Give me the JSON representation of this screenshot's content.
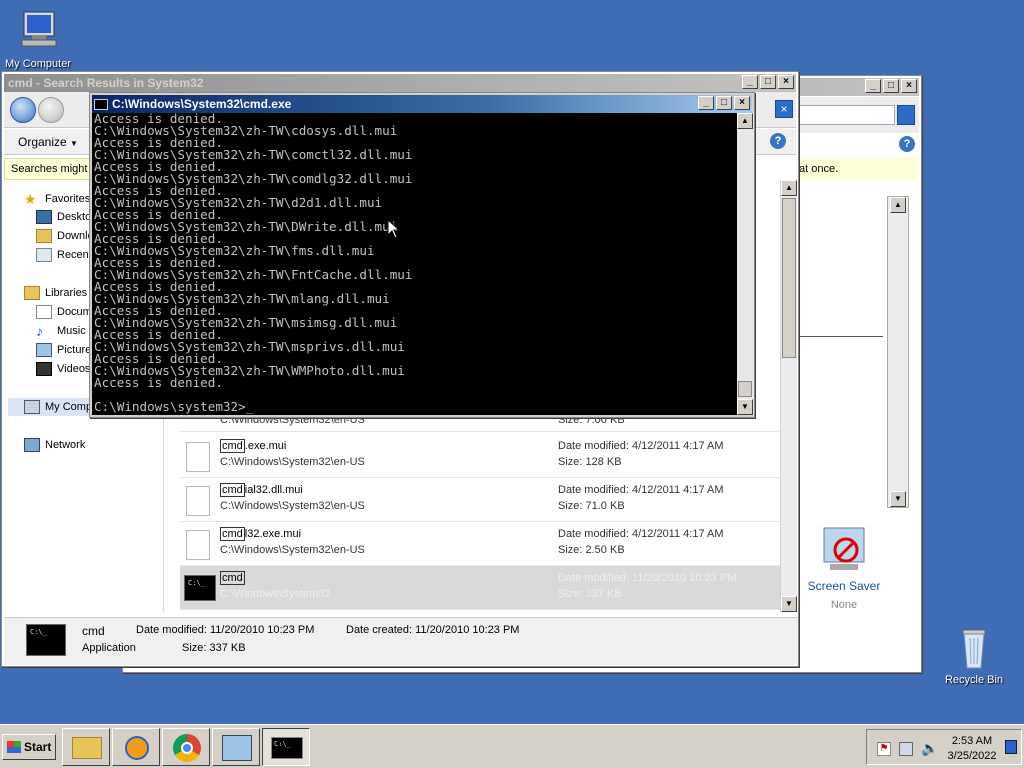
{
  "desktop": {
    "icons": [
      {
        "label": "My Computer"
      },
      {
        "label": "Recycle Bin"
      }
    ]
  },
  "explorer": {
    "title": "cmd - Search Results in System32",
    "toolbar": {
      "organize_label": "Organize"
    },
    "infobar_text": "Searches might b",
    "nav": {
      "favorites": "Favorites",
      "desktop": "Deskto",
      "downloads": "Downlo",
      "recent": "Recent",
      "libraries": "Libraries",
      "documents": "Docume",
      "music": "Music",
      "pictures": "Picture",
      "videos": "Videos",
      "computer": "My Comp",
      "network": "Network"
    },
    "results": [
      {
        "name_hl": "",
        "name_rest": "",
        "path": "C:\\Windows\\System32\\en-US",
        "date": "",
        "size": "Size: 7.00 KB"
      },
      {
        "name_hl": "cmd",
        "name_rest": ".exe.mui",
        "path": "C:\\Windows\\System32\\en-US",
        "date": "Date modified: 4/12/2011 4:17 AM",
        "size": "Size: 128 KB"
      },
      {
        "name_hl": "cmd",
        "name_rest": "ial32.dll.mui",
        "path": "C:\\Windows\\System32\\en-US",
        "date": "Date modified: 4/12/2011 4:17 AM",
        "size": "Size: 71.0 KB"
      },
      {
        "name_hl": "cmd",
        "name_rest": "l32.exe.mui",
        "path": "C:\\Windows\\System32\\en-US",
        "date": "Date modified: 4/12/2011 4:17 AM",
        "size": "Size: 2.50 KB"
      },
      {
        "name_hl": "cmd",
        "name_rest": "",
        "path": "C:\\Windows\\System32",
        "date": "Date modified: 11/20/2010 10:23 PM",
        "size": "Size: 337 KB"
      }
    ],
    "details": {
      "name": "cmd",
      "type": "Application",
      "modified": "Date modified: 11/20/2010 10:23 PM",
      "size": "Size: 337 KB",
      "created": "Date created: 11/20/2010 10:23 PM"
    }
  },
  "controlpanel": {
    "partial_text": "at once.",
    "screensaver_label": "Screen Saver",
    "screensaver_value": "None"
  },
  "cmd": {
    "title": "C:\\Windows\\System32\\cmd.exe",
    "lines": [
      "Access is denied.",
      "C:\\Windows\\System32\\zh-TW\\cdosys.dll.mui",
      "Access is denied.",
      "C:\\Windows\\System32\\zh-TW\\comctl32.dll.mui",
      "Access is denied.",
      "C:\\Windows\\System32\\zh-TW\\comdlg32.dll.mui",
      "Access is denied.",
      "C:\\Windows\\System32\\zh-TW\\d2d1.dll.mui",
      "Access is denied.",
      "C:\\Windows\\System32\\zh-TW\\DWrite.dll.mui",
      "Access is denied.",
      "C:\\Windows\\System32\\zh-TW\\fms.dll.mui",
      "Access is denied.",
      "C:\\Windows\\System32\\zh-TW\\FntCache.dll.mui",
      "Access is denied.",
      "C:\\Windows\\System32\\zh-TW\\mlang.dll.mui",
      "Access is denied.",
      "C:\\Windows\\System32\\zh-TW\\msimsg.dll.mui",
      "Access is denied.",
      "C:\\Windows\\System32\\zh-TW\\msprivs.dll.mui",
      "Access is denied.",
      "C:\\Windows\\System32\\zh-TW\\WMPhoto.dll.mui",
      "Access is denied.",
      "",
      "C:\\Windows\\system32>_"
    ]
  },
  "taskbar": {
    "start_label": "Start",
    "time": "2:53 AM",
    "date": "3/25/2022"
  },
  "colors": {
    "desktop": "#3f6db5",
    "active_title": "#0a246a",
    "console_bg": "#000000",
    "console_fg": "#c0c0c0"
  }
}
